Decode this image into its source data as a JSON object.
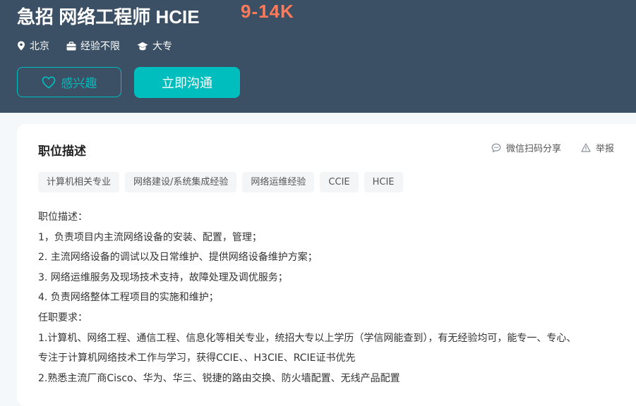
{
  "header": {
    "title": "急招 网络工程师 HCIE",
    "salary": "9-14K",
    "meta": [
      {
        "icon": "location-pin-icon",
        "text": "北京"
      },
      {
        "icon": "briefcase-icon",
        "text": "经验不限"
      },
      {
        "icon": "graduation-cap-icon",
        "text": "大专"
      }
    ],
    "interest_button": "感兴趣",
    "chat_button": "立即沟通"
  },
  "colors": {
    "hero_bg": "#3b4f65",
    "accent": "#00bebd",
    "salary": "#ff7a59"
  },
  "section": {
    "title": "职位描述",
    "share_label": "微信扫码分享",
    "report_label": "举报"
  },
  "tags": [
    "计算机相关专业",
    "网络建设/系统集成经验",
    "网络运维经验",
    "CCIE",
    "HCIE"
  ],
  "description": [
    "职位描述：",
    "1，负责项目内主流网络设备的安装、配置，管理；",
    "2. 主流网络设备的调试以及日常维护、提供网络设备维护方案；",
    "3. 网络运维服务及现场技术支持，故障处理及调优服务；",
    "4. 负责网络整体工程项目的实施和维护；",
    "任职要求：",
    "1.计算机、网络工程、通信工程、信息化等相关专业，统招大专以上学历（学信网能查到），有无经验均可，能专一、专心、",
    "专注于计算机网络技术工作与学习，获得CCIE、、H3CIE、RCIE证书优先",
    "2.熟悉主流厂商Cisco、华为、华三、锐捷的路由交换、防火墙配置、无线产品配置"
  ]
}
